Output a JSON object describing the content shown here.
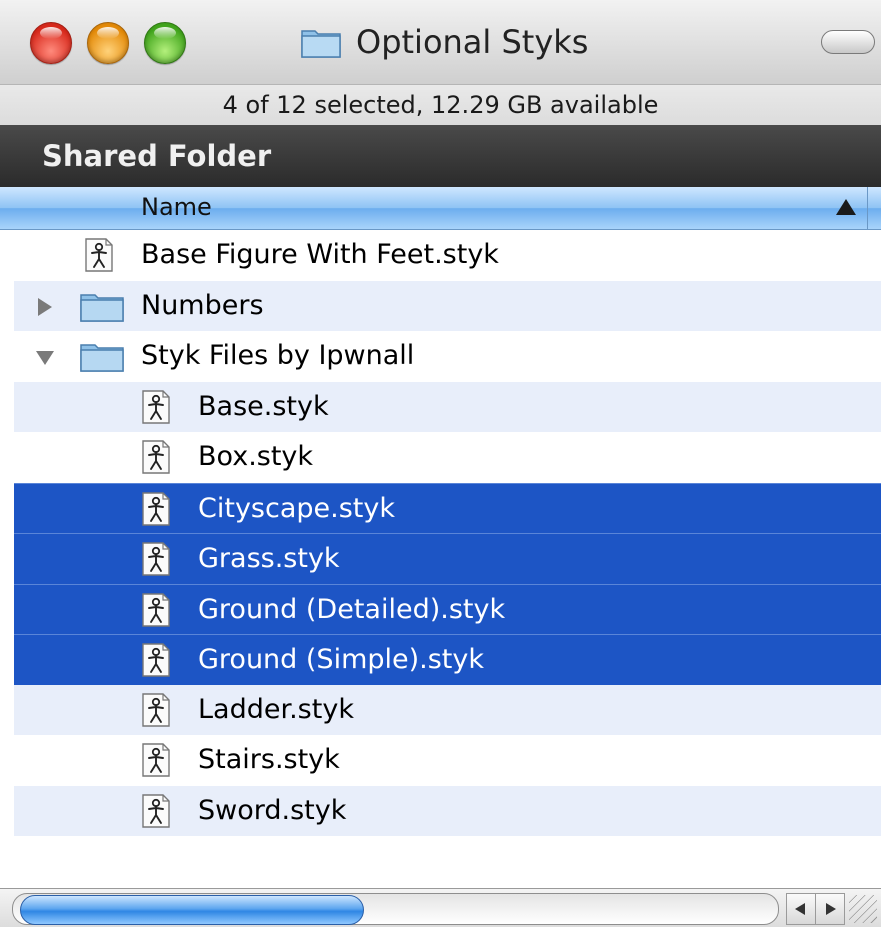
{
  "window": {
    "title": "Optional Styks",
    "title_icon": "folder-icon",
    "traffic_lights": [
      "close",
      "minimize",
      "zoom"
    ],
    "colors": {
      "selection": "#1d55c5",
      "alt_row": "#e8eefa",
      "header_bar": "#2b2b2b"
    }
  },
  "status": {
    "text": "4 of 12 selected, 12.29 GB available"
  },
  "sidebar_header": {
    "label": "Shared Folder"
  },
  "columns": {
    "name_label": "Name",
    "sort": "ascending"
  },
  "rows": [
    {
      "label": "Base Figure With Feet.styk",
      "kind": "file",
      "level": 0,
      "selected": false,
      "alt": false
    },
    {
      "label": "Numbers",
      "kind": "folder",
      "level": 0,
      "disclosure": "collapsed",
      "selected": false,
      "alt": true
    },
    {
      "label": "Styk Files by Ipwnall",
      "kind": "folder",
      "level": 0,
      "disclosure": "expanded",
      "selected": false,
      "alt": false
    },
    {
      "label": "Base.styk",
      "kind": "file",
      "level": 1,
      "selected": false,
      "alt": true
    },
    {
      "label": "Box.styk",
      "kind": "file",
      "level": 1,
      "selected": false,
      "alt": false
    },
    {
      "label": "Cityscape.styk",
      "kind": "file",
      "level": 1,
      "selected": true,
      "alt": true
    },
    {
      "label": "Grass.styk",
      "kind": "file",
      "level": 1,
      "selected": true,
      "alt": false
    },
    {
      "label": "Ground (Detailed).styk",
      "kind": "file",
      "level": 1,
      "selected": true,
      "alt": true
    },
    {
      "label": "Ground (Simple).styk",
      "kind": "file",
      "level": 1,
      "selected": true,
      "alt": false
    },
    {
      "label": "Ladder.styk",
      "kind": "file",
      "level": 1,
      "selected": false,
      "alt": true
    },
    {
      "label": "Stairs.styk",
      "kind": "file",
      "level": 1,
      "selected": false,
      "alt": false
    },
    {
      "label": "Sword.styk",
      "kind": "file",
      "level": 1,
      "selected": false,
      "alt": true
    },
    {
      "label": "",
      "kind": "empty",
      "level": 0,
      "selected": false,
      "alt": false
    }
  ],
  "scrollbar": {
    "orientation": "horizontal",
    "position": 0
  }
}
